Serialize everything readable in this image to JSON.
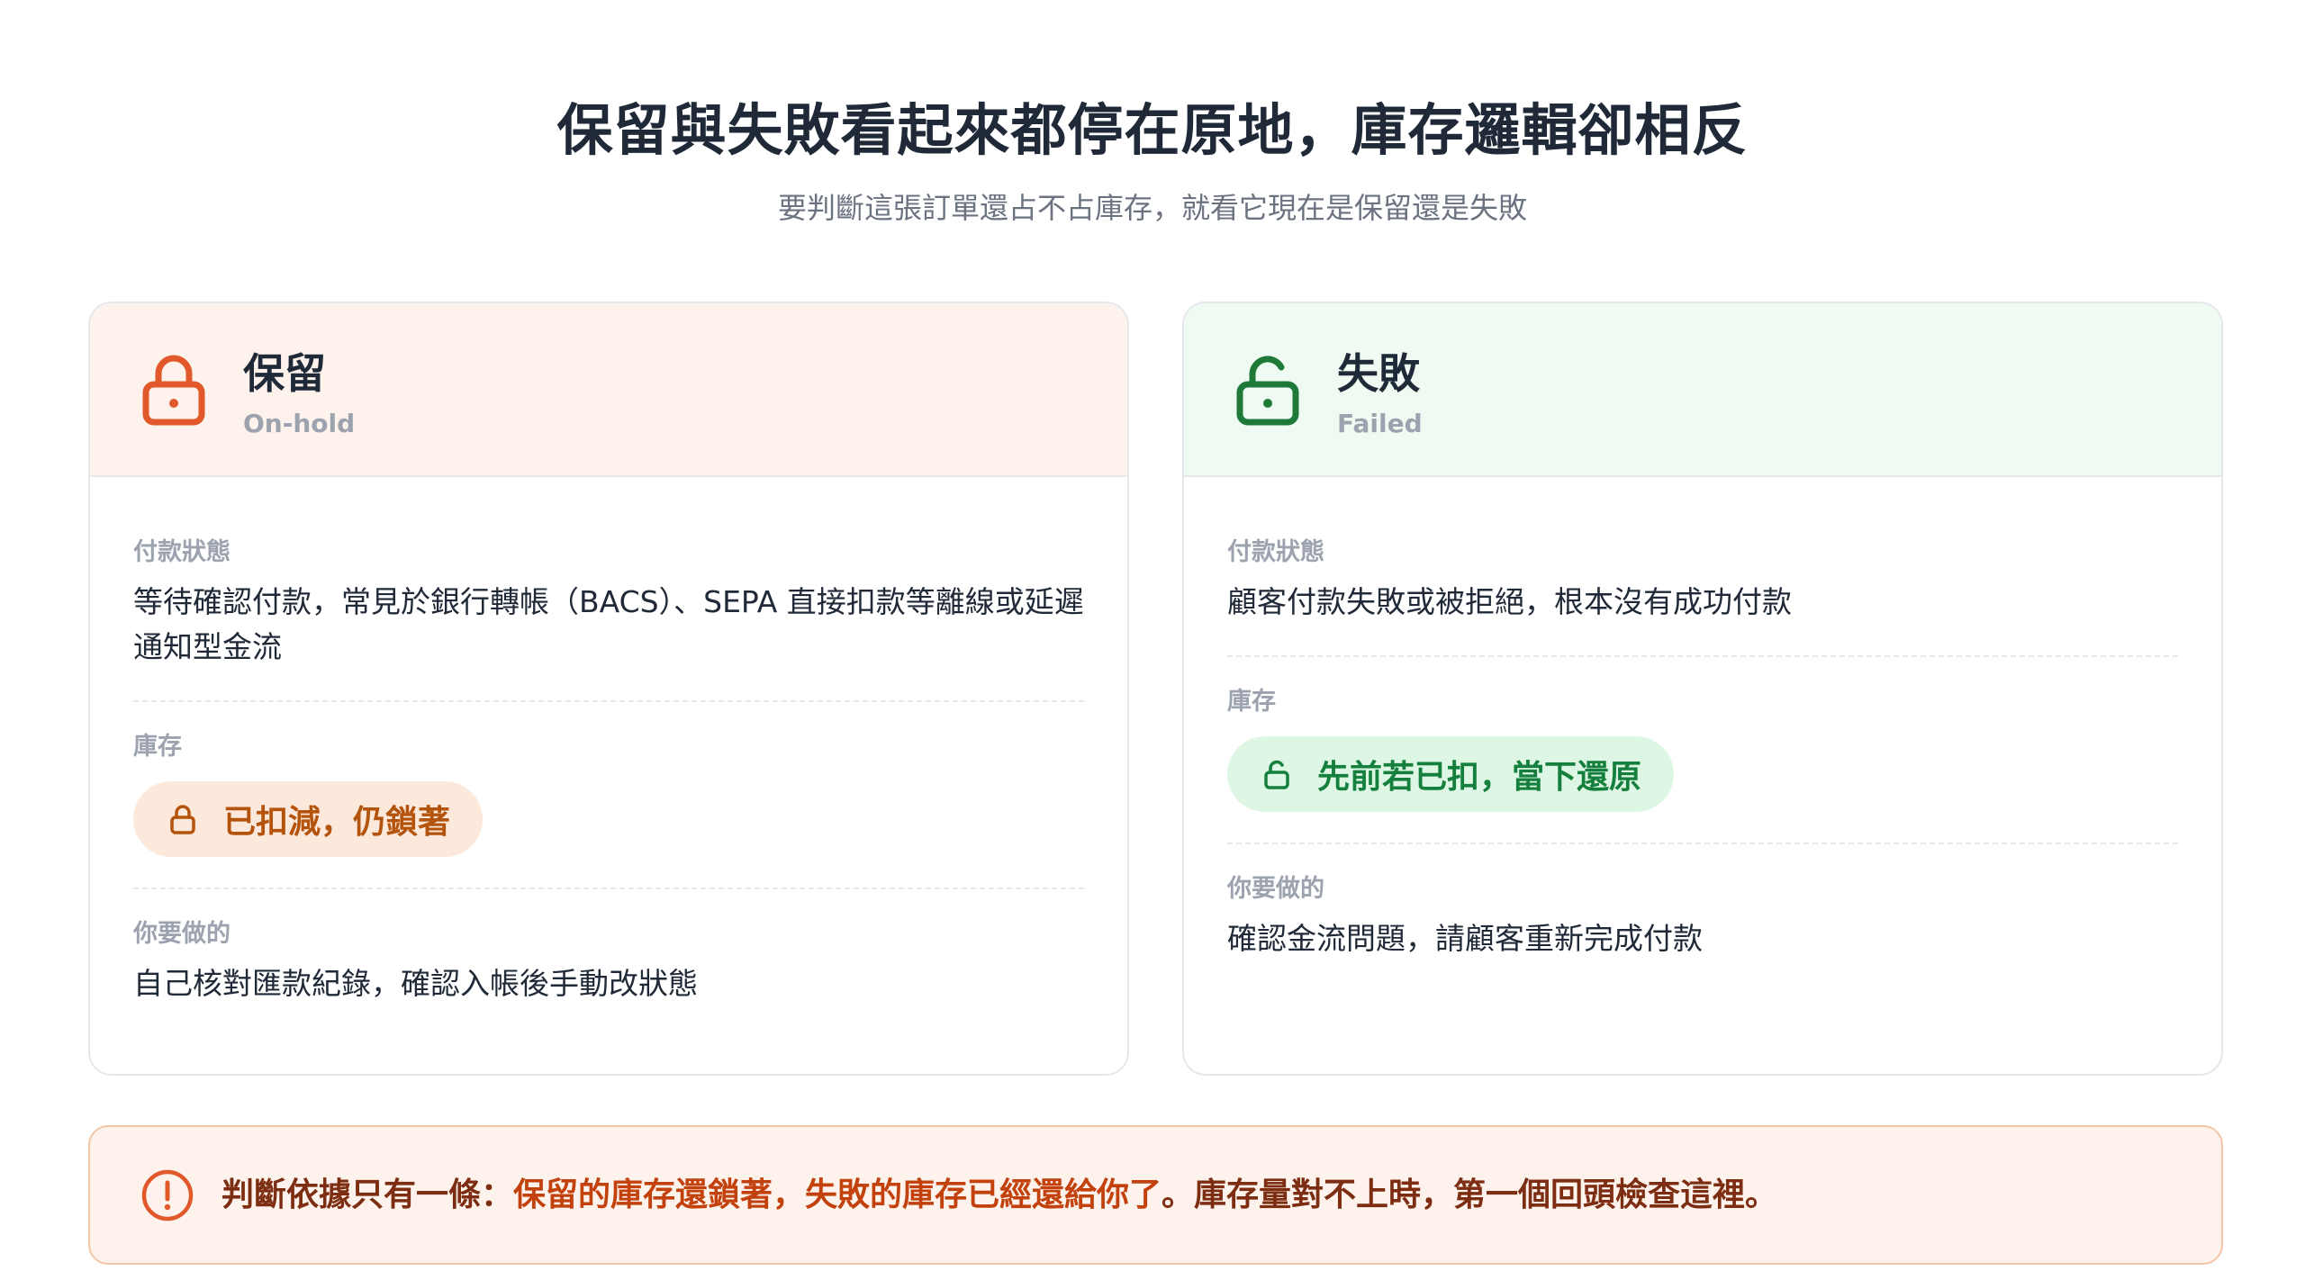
{
  "header": {
    "title": "保留與失敗看起來都停在原地，庫存邏輯卻相反",
    "subtitle": "要判斷這張訂單還占不占庫存，就看它現在是保留還是失敗"
  },
  "cards": [
    {
      "title": "保留",
      "subtitle": "On-hold",
      "icon": "lock-closed-icon",
      "accent": "#e1592a",
      "payment_label": "付款狀態",
      "payment_text": "等待確認付款，常見於銀行轉帳（BACS）、SEPA 直接扣款等離線或延遲通知型金流",
      "stock_label": "庫存",
      "stock_pill": "已扣減，仍鎖著",
      "action_label": "你要做的",
      "action_text": "自己核對匯款紀錄，確認入帳後手動改狀態"
    },
    {
      "title": "失敗",
      "subtitle": "Failed",
      "icon": "lock-open-icon",
      "accent": "#1f7a3a",
      "payment_label": "付款狀態",
      "payment_text": "顧客付款失敗或被拒絕，根本沒有成功付款",
      "stock_label": "庫存",
      "stock_pill": "先前若已扣，當下還原",
      "action_label": "你要做的",
      "action_text": "確認金流問題，請顧客重新完成付款"
    }
  ],
  "callout": {
    "icon": "alert-circle-icon",
    "prefix": "判斷依據只有一條：",
    "highlight": "保留的庫存還鎖著，失敗的庫存已經還給你了",
    "suffix": "。庫存量對不上時，第一個回頭檢查這裡。"
  }
}
